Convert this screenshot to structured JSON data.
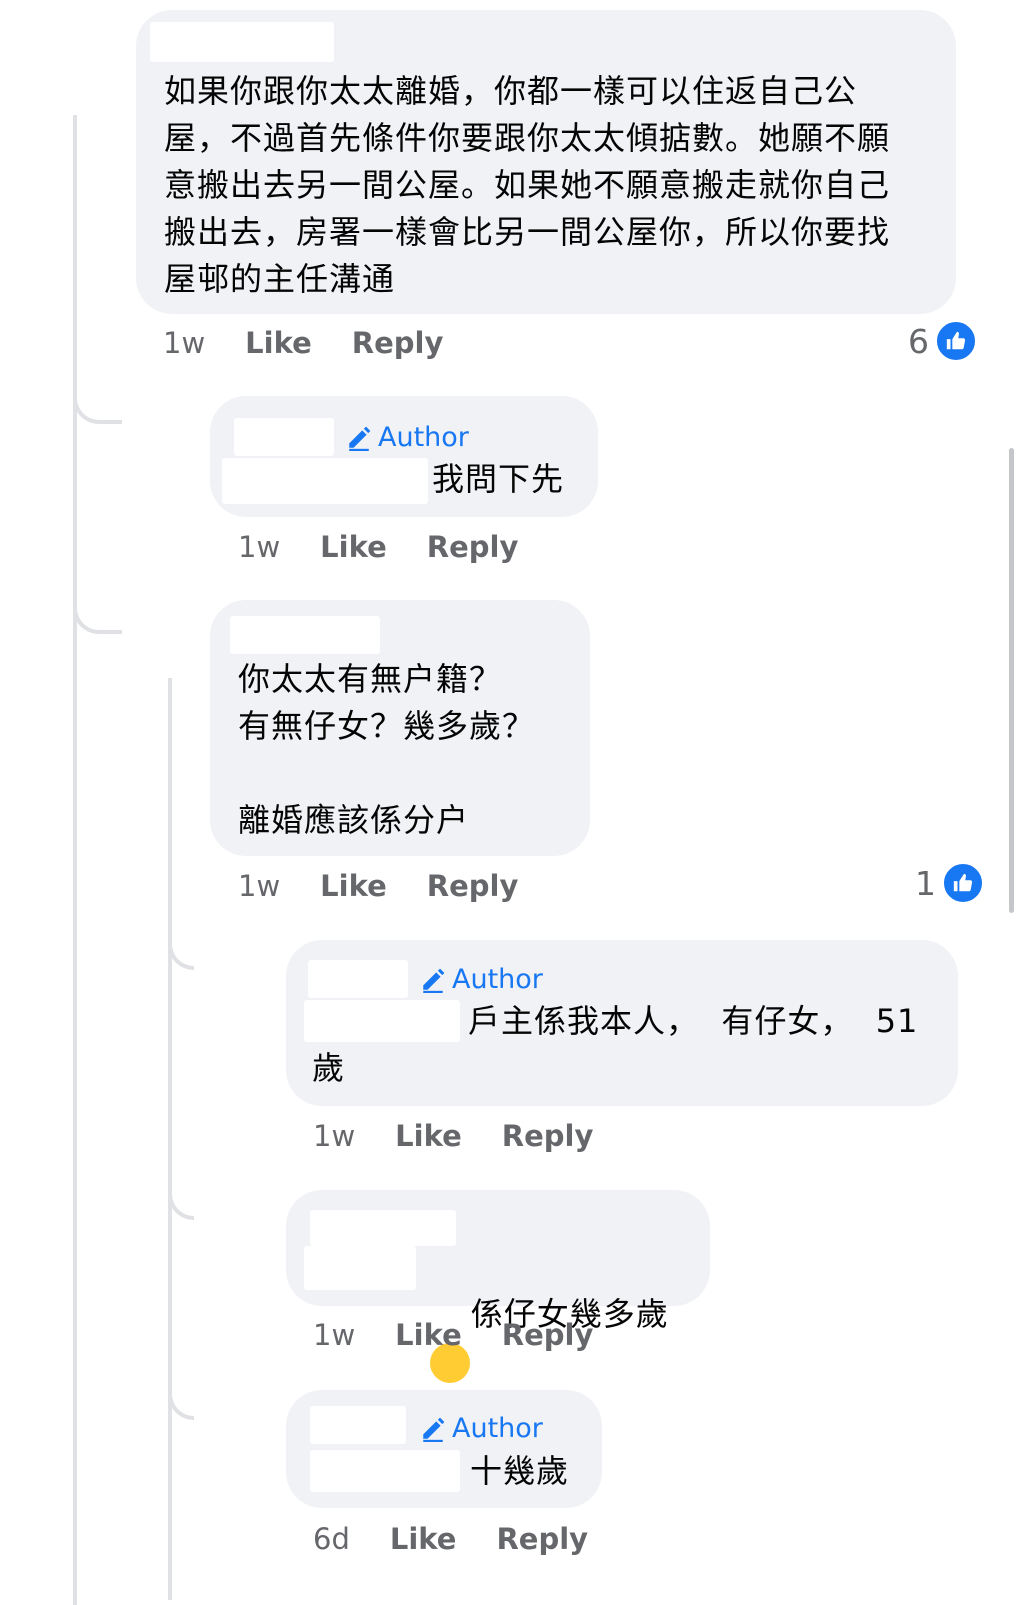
{
  "comments": [
    {
      "text": "如果你跟你太太離婚，你都一樣可以住返自己公\n屋，不過首先條件你要跟你太太傾掂數。她願不願\n意搬出去另一間公屋。如果她不願意搬走就你自己\n搬出去，房署一樣會比另一間公屋你，所以你要找\n屋邨的主任溝通",
      "time": "1w",
      "like": "Like",
      "reply": "Reply",
      "reactions": "6"
    },
    {
      "author": "Author",
      "text": "我問下先",
      "time": "1w",
      "like": "Like",
      "reply": "Reply"
    },
    {
      "text": "你太太有無户籍？\n有無仔女？幾多歲？\n\n離婚應該係分户",
      "time": "1w",
      "like": "Like",
      "reply": "Reply",
      "reactions": "1"
    },
    {
      "author": "Author",
      "text": "戶主係我本人，  有仔女，  51\n歲",
      "time": "1w",
      "like": "Like",
      "reply": "Reply"
    },
    {
      "text": "係仔女幾多歲",
      "emoji": "grinning-squinting-face",
      "time": "1w",
      "like": "Like",
      "reply": "Reply"
    },
    {
      "author": "Author",
      "text": "十幾歲",
      "time": "6d",
      "like": "Like",
      "reply": "Reply"
    }
  ],
  "colors": {
    "bubble": "#f0f2f5",
    "author": "#1877f2",
    "meta": "#65676b",
    "thread": "#dfe1e5"
  },
  "icons": {
    "author": "pencil-icon",
    "reaction": "thumbs-up-icon"
  }
}
